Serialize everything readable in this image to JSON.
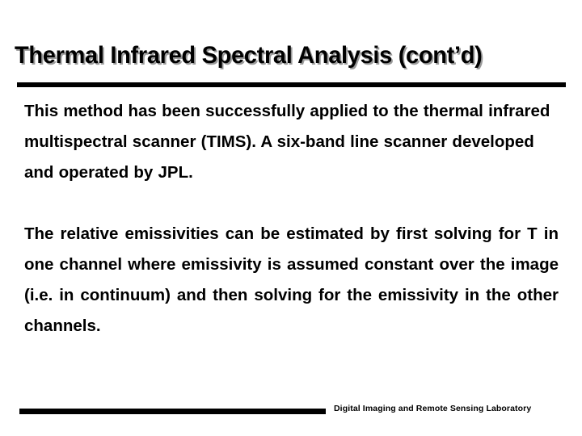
{
  "slide": {
    "title": "Thermal Infrared Spectral Analysis (cont’d)",
    "paragraphs": [
      {
        "id": "paragraph-1",
        "align": "left",
        "text": "This method has been successfully applied to the thermal infrared multispectral scanner (TIMS).  A six-band line scanner developed and operated by JPL."
      },
      {
        "id": "paragraph-2",
        "align": "justify",
        "text": "The relative emissivities can be estimated by first solving for T in one channel where emissivity is assumed constant over the image (i.e. in continuum) and then solving for the emissivity in the other channels."
      }
    ],
    "footer": {
      "label": "Digital Imaging and Remote Sensing Laboratory"
    },
    "colors": {
      "background": "#ffffff",
      "text": "#000000",
      "title_shadow": "#9a9a9a",
      "rule": "#000000"
    }
  }
}
